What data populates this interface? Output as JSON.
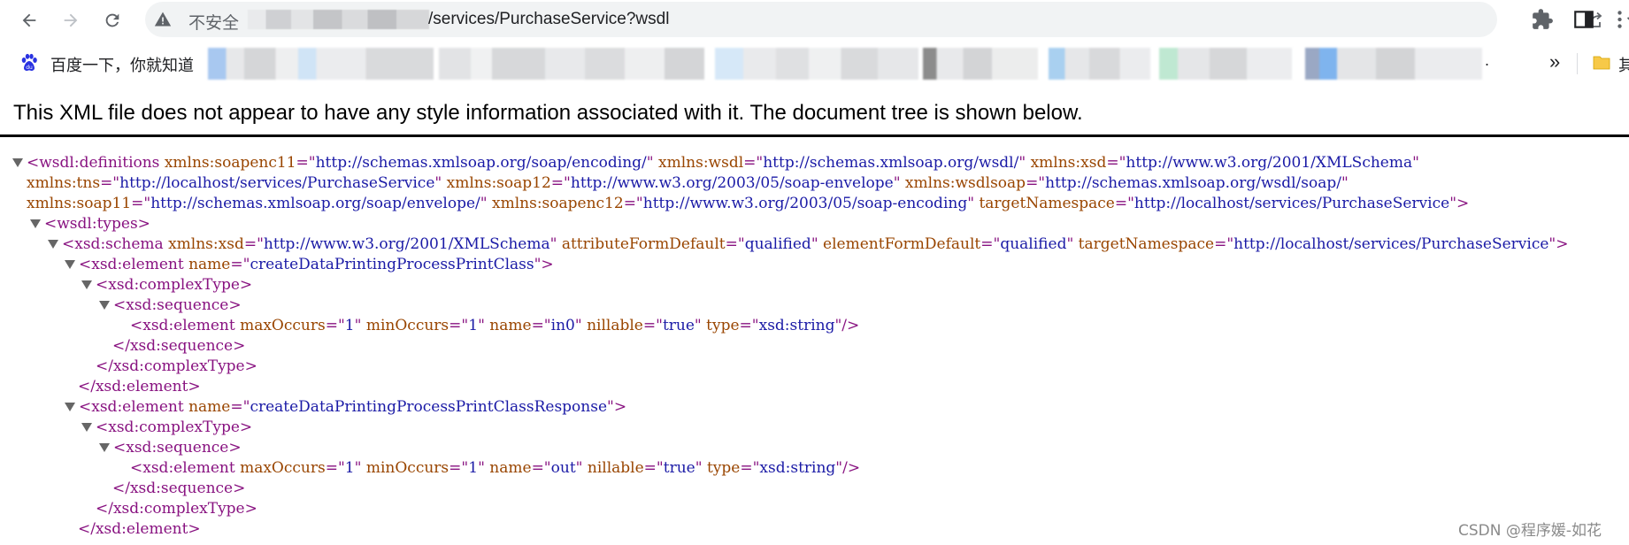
{
  "browser": {
    "address_bar": {
      "security_label": "不安全",
      "path": "/services/PurchaseService?wsdl"
    },
    "icons": {
      "back": "arrow-left-icon",
      "forward": "arrow-right-icon",
      "reload": "reload-icon",
      "warning": "warning-triangle-icon",
      "share": "share-icon",
      "bookmark": "star-icon",
      "extensions": "puzzle-icon",
      "side_panel": "side-panel-icon"
    },
    "bookmarks_bar": {
      "first_item": "百度一下，你就知道",
      "trailing_dot": ".",
      "overflow": "»",
      "last_folder_label": "其"
    }
  },
  "xml_viewer": {
    "notice": "This XML file does not appear to have any style information associated with it. The document tree is shown below.",
    "lines": [
      {
        "fold": true,
        "parts": [
          {
            "t": "tag",
            "v": "<wsdl:definitions"
          },
          {
            "t": "an",
            "v": " xmlns:soapenc11"
          },
          {
            "t": "tag",
            "v": "=\""
          },
          {
            "t": "av",
            "v": "http://schemas.xmlsoap.org/soap/encoding/"
          },
          {
            "t": "tag",
            "v": "\""
          },
          {
            "t": "an",
            "v": " xmlns:wsdl"
          },
          {
            "t": "tag",
            "v": "=\""
          },
          {
            "t": "av",
            "v": "http://schemas.xmlsoap.org/wsdl/"
          },
          {
            "t": "tag",
            "v": "\""
          },
          {
            "t": "an",
            "v": " xmlns:xsd"
          },
          {
            "t": "tag",
            "v": "=\""
          },
          {
            "t": "av",
            "v": "http://www.w3.org/2001/XMLSchema"
          },
          {
            "t": "tag",
            "v": "\""
          }
        ]
      },
      {
        "fold": false,
        "parts": [
          {
            "t": "an",
            "v": "xmlns:tns"
          },
          {
            "t": "tag",
            "v": "=\""
          },
          {
            "t": "av",
            "v": "http://localhost/services/PurchaseService"
          },
          {
            "t": "tag",
            "v": "\""
          },
          {
            "t": "an",
            "v": " xmlns:soap12"
          },
          {
            "t": "tag",
            "v": "=\""
          },
          {
            "t": "av",
            "v": "http://www.w3.org/2003/05/soap-envelope"
          },
          {
            "t": "tag",
            "v": "\""
          },
          {
            "t": "an",
            "v": " xmlns:wsdlsoap"
          },
          {
            "t": "tag",
            "v": "=\""
          },
          {
            "t": "av",
            "v": "http://schemas.xmlsoap.org/wsdl/soap/"
          },
          {
            "t": "tag",
            "v": "\""
          }
        ]
      },
      {
        "fold": false,
        "parts": [
          {
            "t": "an",
            "v": "xmlns:soap11"
          },
          {
            "t": "tag",
            "v": "=\""
          },
          {
            "t": "av",
            "v": "http://schemas.xmlsoap.org/soap/envelope/"
          },
          {
            "t": "tag",
            "v": "\""
          },
          {
            "t": "an",
            "v": " xmlns:soapenc12"
          },
          {
            "t": "tag",
            "v": "=\""
          },
          {
            "t": "av",
            "v": "http://www.w3.org/2003/05/soap-encoding"
          },
          {
            "t": "tag",
            "v": "\""
          },
          {
            "t": "an",
            "v": " targetNamespace"
          },
          {
            "t": "tag",
            "v": "=\""
          },
          {
            "t": "av",
            "v": "http://localhost/services/PurchaseService"
          },
          {
            "t": "tag",
            "v": "\">"
          }
        ]
      },
      {
        "fold": true,
        "parts": [
          {
            "t": "tag",
            "v": "<wsdl:types>"
          }
        ]
      },
      {
        "fold": true,
        "parts": [
          {
            "t": "tag",
            "v": "<xsd:schema"
          },
          {
            "t": "an",
            "v": " xmlns:xsd"
          },
          {
            "t": "tag",
            "v": "=\""
          },
          {
            "t": "av",
            "v": "http://www.w3.org/2001/XMLSchema"
          },
          {
            "t": "tag",
            "v": "\""
          },
          {
            "t": "an",
            "v": " attributeFormDefault"
          },
          {
            "t": "tag",
            "v": "=\""
          },
          {
            "t": "av",
            "v": "qualified"
          },
          {
            "t": "tag",
            "v": "\""
          },
          {
            "t": "an",
            "v": " elementFormDefault"
          },
          {
            "t": "tag",
            "v": "=\""
          },
          {
            "t": "av",
            "v": "qualified"
          },
          {
            "t": "tag",
            "v": "\""
          },
          {
            "t": "an",
            "v": " targetNamespace"
          },
          {
            "t": "tag",
            "v": "=\""
          },
          {
            "t": "av",
            "v": "http://localhost/services/PurchaseService"
          },
          {
            "t": "tag",
            "v": "\">"
          }
        ]
      },
      {
        "fold": true,
        "parts": [
          {
            "t": "tag",
            "v": "<xsd:element"
          },
          {
            "t": "an",
            "v": " name"
          },
          {
            "t": "tag",
            "v": "=\""
          },
          {
            "t": "av",
            "v": "createDataPrintingProcessPrintClass"
          },
          {
            "t": "tag",
            "v": "\">"
          }
        ]
      },
      {
        "fold": true,
        "parts": [
          {
            "t": "tag",
            "v": "<xsd:complexType>"
          }
        ]
      },
      {
        "fold": true,
        "parts": [
          {
            "t": "tag",
            "v": "<xsd:sequence>"
          }
        ]
      },
      {
        "fold": false,
        "parts": [
          {
            "t": "tag",
            "v": "<xsd:element"
          },
          {
            "t": "an",
            "v": " maxOccurs"
          },
          {
            "t": "tag",
            "v": "=\""
          },
          {
            "t": "av",
            "v": "1"
          },
          {
            "t": "tag",
            "v": "\""
          },
          {
            "t": "an",
            "v": " minOccurs"
          },
          {
            "t": "tag",
            "v": "=\""
          },
          {
            "t": "av",
            "v": "1"
          },
          {
            "t": "tag",
            "v": "\""
          },
          {
            "t": "an",
            "v": " name"
          },
          {
            "t": "tag",
            "v": "=\""
          },
          {
            "t": "av",
            "v": "in0"
          },
          {
            "t": "tag",
            "v": "\""
          },
          {
            "t": "an",
            "v": " nillable"
          },
          {
            "t": "tag",
            "v": "=\""
          },
          {
            "t": "av",
            "v": "true"
          },
          {
            "t": "tag",
            "v": "\""
          },
          {
            "t": "an",
            "v": " type"
          },
          {
            "t": "tag",
            "v": "=\""
          },
          {
            "t": "av",
            "v": "xsd:string"
          },
          {
            "t": "tag",
            "v": "\"/>"
          }
        ]
      },
      {
        "fold": false,
        "parts": [
          {
            "t": "tag",
            "v": "</xsd:sequence>"
          }
        ]
      },
      {
        "fold": false,
        "parts": [
          {
            "t": "tag",
            "v": "</xsd:complexType>"
          }
        ]
      },
      {
        "fold": false,
        "parts": [
          {
            "t": "tag",
            "v": "</xsd:element>"
          }
        ]
      },
      {
        "fold": true,
        "parts": [
          {
            "t": "tag",
            "v": "<xsd:element"
          },
          {
            "t": "an",
            "v": " name"
          },
          {
            "t": "tag",
            "v": "=\""
          },
          {
            "t": "av",
            "v": "createDataPrintingProcessPrintClassResponse"
          },
          {
            "t": "tag",
            "v": "\">"
          }
        ]
      },
      {
        "fold": true,
        "parts": [
          {
            "t": "tag",
            "v": "<xsd:complexType>"
          }
        ]
      },
      {
        "fold": true,
        "parts": [
          {
            "t": "tag",
            "v": "<xsd:sequence>"
          }
        ]
      },
      {
        "fold": false,
        "parts": [
          {
            "t": "tag",
            "v": "<xsd:element"
          },
          {
            "t": "an",
            "v": " maxOccurs"
          },
          {
            "t": "tag",
            "v": "=\""
          },
          {
            "t": "av",
            "v": "1"
          },
          {
            "t": "tag",
            "v": "\""
          },
          {
            "t": "an",
            "v": " minOccurs"
          },
          {
            "t": "tag",
            "v": "=\""
          },
          {
            "t": "av",
            "v": "1"
          },
          {
            "t": "tag",
            "v": "\""
          },
          {
            "t": "an",
            "v": " name"
          },
          {
            "t": "tag",
            "v": "=\""
          },
          {
            "t": "av",
            "v": "out"
          },
          {
            "t": "tag",
            "v": "\""
          },
          {
            "t": "an",
            "v": " nillable"
          },
          {
            "t": "tag",
            "v": "=\""
          },
          {
            "t": "av",
            "v": "true"
          },
          {
            "t": "tag",
            "v": "\""
          },
          {
            "t": "an",
            "v": " type"
          },
          {
            "t": "tag",
            "v": "=\""
          },
          {
            "t": "av",
            "v": "xsd:string"
          },
          {
            "t": "tag",
            "v": "\"/>"
          }
        ]
      },
      {
        "fold": false,
        "parts": [
          {
            "t": "tag",
            "v": "</xsd:sequence>"
          }
        ]
      },
      {
        "fold": false,
        "parts": [
          {
            "t": "tag",
            "v": "</xsd:complexType>"
          }
        ]
      },
      {
        "fold": false,
        "parts": [
          {
            "t": "tag",
            "v": "</xsd:element>"
          }
        ]
      }
    ],
    "colors": {
      "tag": "#881280",
      "attribute_name": "#994500",
      "attribute_value": "#1a1aa6",
      "fold_arrow": "#666666"
    }
  },
  "watermark": "CSDN @程序媛-如花"
}
